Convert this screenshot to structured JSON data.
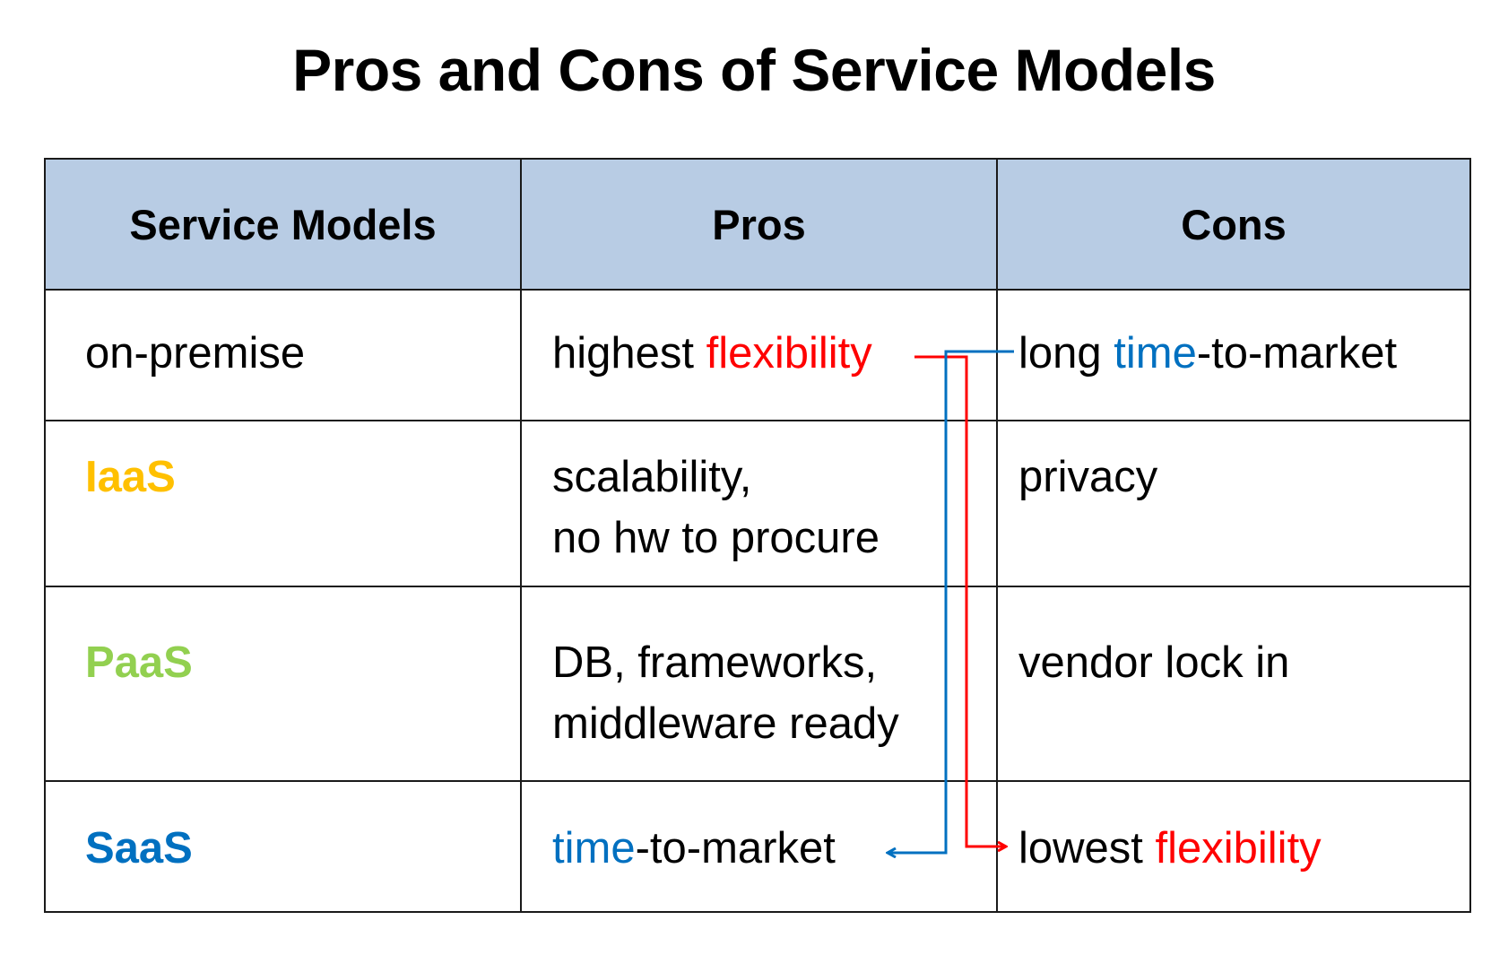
{
  "title": "Pros and Cons of Service Models",
  "colors": {
    "header_bg": "#b8cce4",
    "iaas": "#ffc000",
    "paas": "#92d050",
    "saas": "#0070c0",
    "highlight_red": "#ff0000",
    "highlight_blue": "#0070c0"
  },
  "table": {
    "headers": [
      "Service Models",
      "Pros",
      "Cons"
    ],
    "rows": [
      {
        "model": "on-premise",
        "pros": {
          "prefix": "highest ",
          "highlight": "flexibility",
          "suffix": ""
        },
        "cons": {
          "prefix": "long ",
          "highlight": "time",
          "suffix": "-to-market"
        }
      },
      {
        "model": "IaaS",
        "pros": {
          "line1": "scalability,",
          "line2": "no hw to procure"
        },
        "cons": {
          "text": "privacy"
        }
      },
      {
        "model": "PaaS",
        "pros": {
          "line1": "DB, frameworks,",
          "line2": "middleware ready"
        },
        "cons": {
          "text": "vendor lock in"
        }
      },
      {
        "model": "SaaS",
        "pros": {
          "prefix": "",
          "highlight": "time",
          "suffix": "-to-market"
        },
        "cons": {
          "prefix": "lowest ",
          "highlight": "flexibility",
          "suffix": ""
        }
      }
    ]
  },
  "connectors": [
    {
      "name": "flexibility-connector",
      "color": "red",
      "from": "highest flexibility",
      "to": "lowest flexibility"
    },
    {
      "name": "time-to-market-connector",
      "color": "blue",
      "from": "long time-to-market",
      "to": "time-to-market"
    }
  ]
}
